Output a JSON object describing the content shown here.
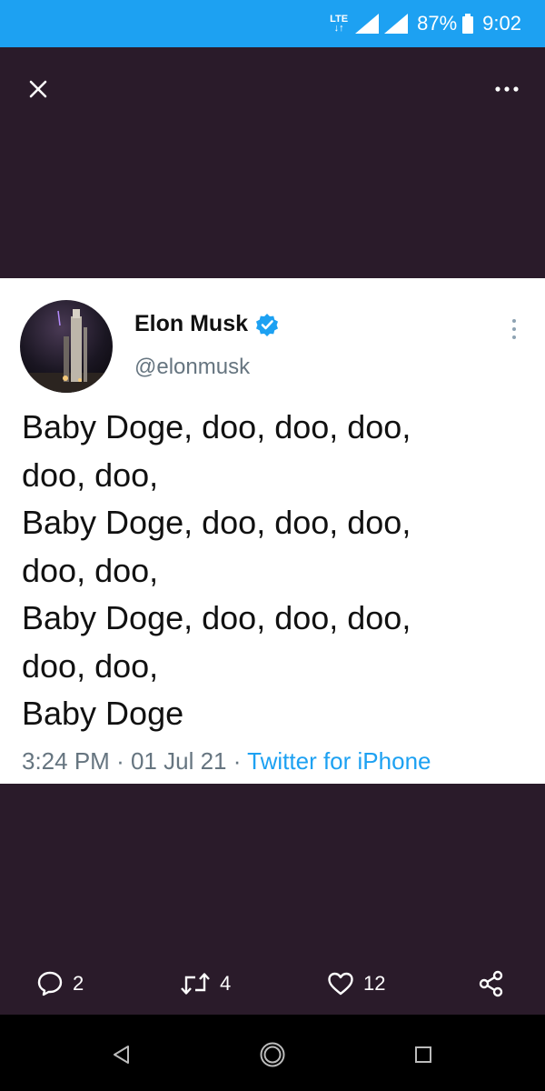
{
  "status_bar": {
    "network": "LTE",
    "battery": "87%",
    "time": "9:02"
  },
  "viewer": {
    "close_icon": "close-icon",
    "more_icon": "more-horizontal-icon"
  },
  "tweet": {
    "author_name": "Elon Musk",
    "verified": true,
    "handle": "@elonmusk",
    "lines": [
      "Baby Doge, doo, doo, doo,",
      "doo, doo,",
      "Baby Doge, doo, doo, doo,",
      "doo, doo,",
      "Baby Doge, doo, doo, doo,",
      "doo, doo,",
      "Baby Doge"
    ],
    "time": "3:24 PM",
    "date": "01 Jul 21",
    "source": "Twitter for iPhone",
    "separator": "·"
  },
  "actions": {
    "reply_count": "2",
    "retweet_count": "4",
    "like_count": "12"
  },
  "colors": {
    "accent": "#1da1f2",
    "viewer_bg": "#2a1b2a",
    "card_bg": "#ffffff",
    "muted": "#667580"
  }
}
